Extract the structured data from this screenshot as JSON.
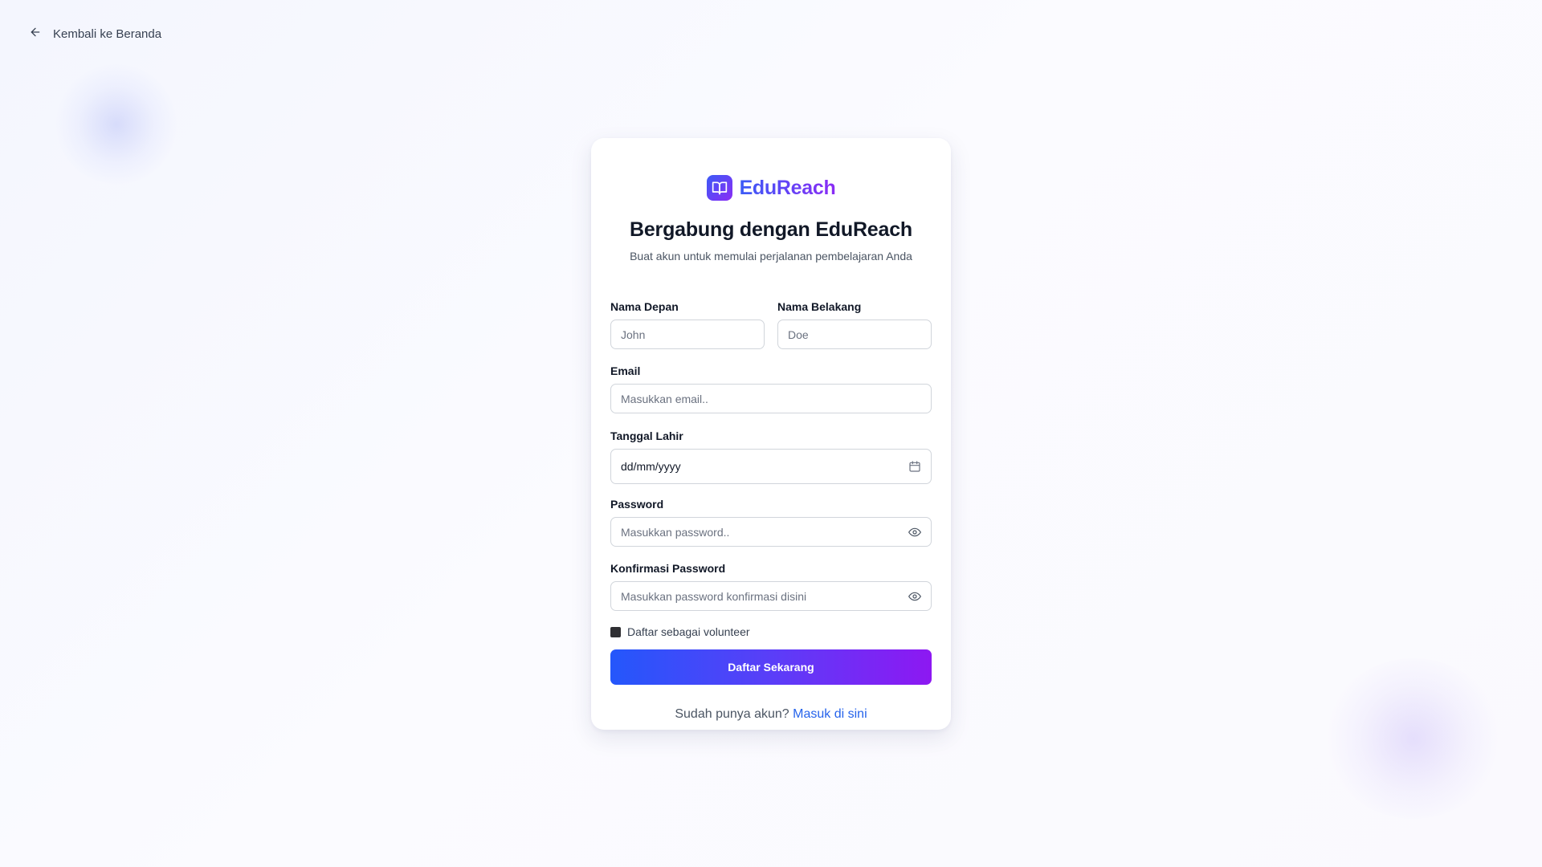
{
  "nav": {
    "back_label": "Kembali ke Beranda"
  },
  "brand": {
    "name": "EduReach"
  },
  "header": {
    "title": "Bergabung dengan EduReach",
    "subtitle": "Buat akun untuk memulai perjalanan pembelajaran Anda"
  },
  "form": {
    "first_name": {
      "label": "Nama Depan",
      "placeholder": "John"
    },
    "last_name": {
      "label": "Nama Belakang",
      "placeholder": "Doe"
    },
    "email": {
      "label": "Email",
      "placeholder": "Masukkan email.."
    },
    "birth_date": {
      "label": "Tanggal Lahir",
      "value": "dd/mm/yyyy"
    },
    "password": {
      "label": "Password",
      "placeholder": "Masukkan password.."
    },
    "confirm_password": {
      "label": "Konfirmasi Password",
      "placeholder": "Masukkan password konfirmasi disini"
    },
    "volunteer_checkbox": {
      "label": "Daftar sebagai volunteer",
      "checked": false
    },
    "submit_label": "Daftar Sekarang"
  },
  "footer": {
    "prompt": "Sudah punya akun?",
    "login_link": "Masuk di sini"
  },
  "icons": {
    "back": "arrow-left-icon",
    "logo": "book-open-icon",
    "calendar": "calendar-icon",
    "password_toggle": "eye-icon"
  },
  "colors": {
    "gradient_start": "#2457fb",
    "gradient_end": "#8d18f2",
    "link": "#2563eb"
  }
}
